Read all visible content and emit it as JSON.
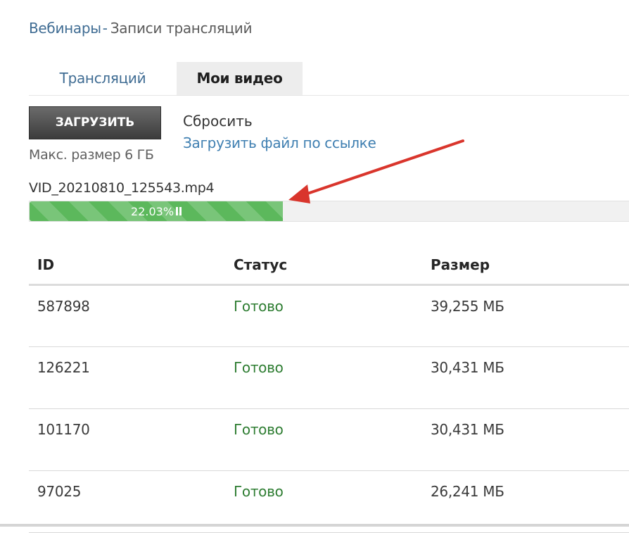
{
  "breadcrumb": {
    "parent": "Вебинары",
    "separator": "-",
    "current": "Записи трансляций"
  },
  "tabs": [
    {
      "label": "Трансляций"
    },
    {
      "label": "Мои видео"
    }
  ],
  "upload": {
    "button_label": "ЗАГРУЗИТЬ",
    "reset_label": "Сбросить",
    "url_link_label": "Загрузить файл по ссылке",
    "max_size_text": "Макс. размер 6 ГБ"
  },
  "progress": {
    "filename": "VID_20210810_125543.mp4",
    "percent_label": "22.03%",
    "fraction": 0.4226
  },
  "colors": {
    "accent_link": "#3f7fb1",
    "status_ready": "#2e7d32",
    "progress": "#5cb85c",
    "arrow": "#d9352c"
  },
  "table": {
    "headers": {
      "id": "ID",
      "status": "Статус",
      "size": "Размер"
    },
    "rows": [
      {
        "id": "587898",
        "status": "Готово",
        "size": "39,255 МБ"
      },
      {
        "id": "126221",
        "status": "Готово",
        "size": "30,431 МБ"
      },
      {
        "id": "101170",
        "status": "Готово",
        "size": "30,431 МБ"
      },
      {
        "id": "97025",
        "status": "Готово",
        "size": "26,241 МБ"
      }
    ]
  }
}
